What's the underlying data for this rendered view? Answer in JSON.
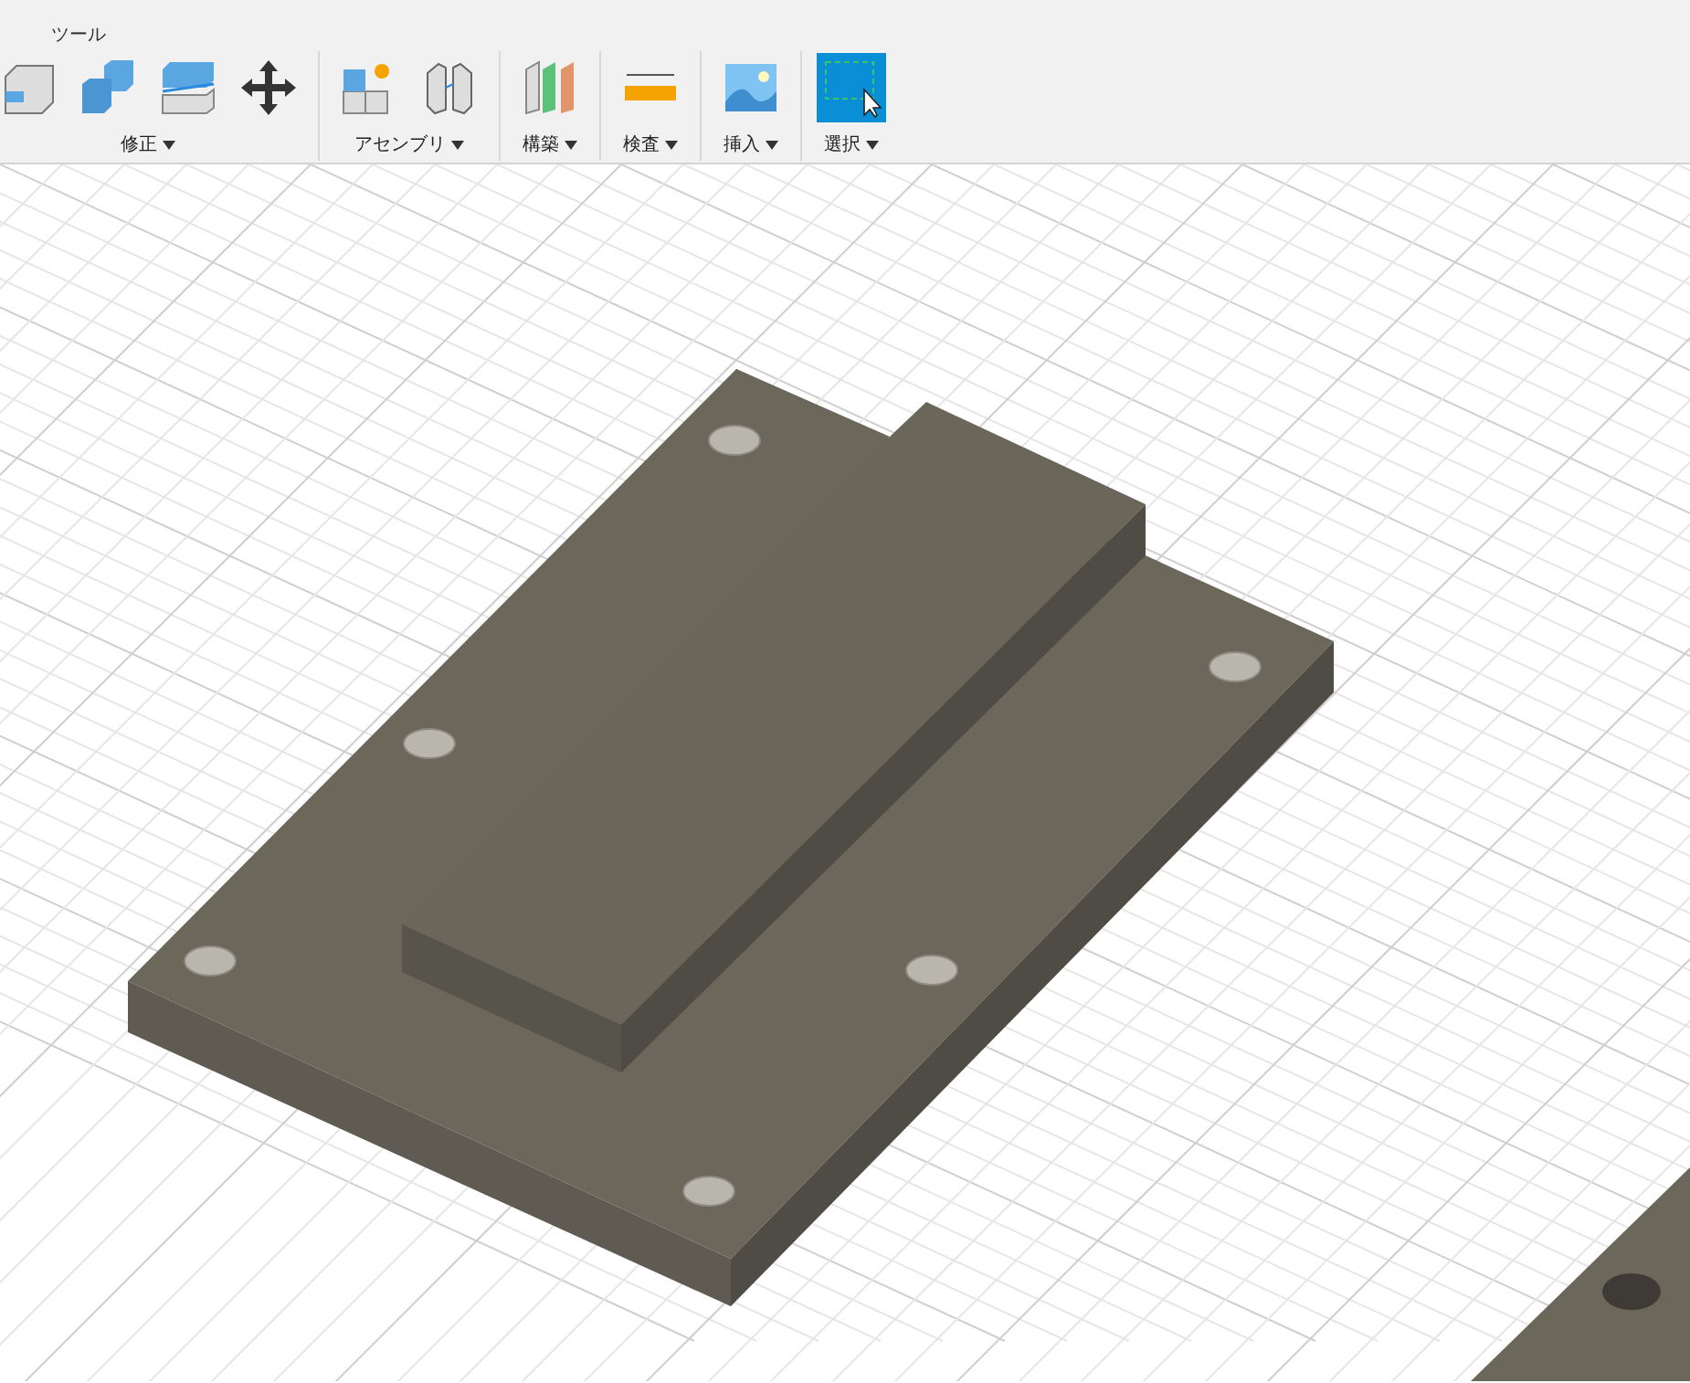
{
  "toolbar": {
    "tab_label": "ツール",
    "groups": [
      {
        "label": "修正",
        "tools": [
          {
            "kind": "box",
            "selected": false
          },
          {
            "kind": "combine",
            "selected": false
          },
          {
            "kind": "split",
            "selected": false
          },
          {
            "kind": "move",
            "selected": false
          }
        ]
      },
      {
        "label": "アセンブリ",
        "tools": [
          {
            "kind": "new-component",
            "selected": false
          },
          {
            "kind": "joint",
            "selected": false
          }
        ]
      },
      {
        "label": "構築",
        "tools": [
          {
            "kind": "plane",
            "selected": false
          }
        ]
      },
      {
        "label": "検査",
        "tools": [
          {
            "kind": "measure",
            "selected": false
          }
        ]
      },
      {
        "label": "挿入",
        "tools": [
          {
            "kind": "image",
            "selected": false
          }
        ]
      },
      {
        "label": "選択",
        "tools": [
          {
            "kind": "select",
            "selected": true
          }
        ]
      }
    ]
  }
}
